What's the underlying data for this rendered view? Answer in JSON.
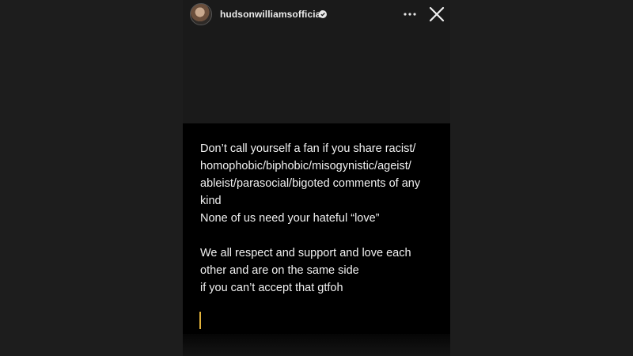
{
  "header": {
    "username": "hudsonwilliamsofficial",
    "avatar_icon": "profile-photo",
    "verified_icon": "verified-badge-icon",
    "more_icon": "more-dots-icon",
    "close_icon": "close-icon"
  },
  "post": {
    "text_block_1": "Don’t call yourself a fan if you share racist/\nhomophobic/biphobic/misogynistic/ageist/\nableist/parasocial/bigoted comments of any\nkind\nNone of us need your hateful “love”",
    "text_block_2": "We all respect and support and love each\nother and are on the same side\nif you can’t accept that gtfoh"
  },
  "colors": {
    "background": "#1d1d1d",
    "card": "#000000",
    "text": "#f1f1f1",
    "caret": "#e2b23c"
  }
}
